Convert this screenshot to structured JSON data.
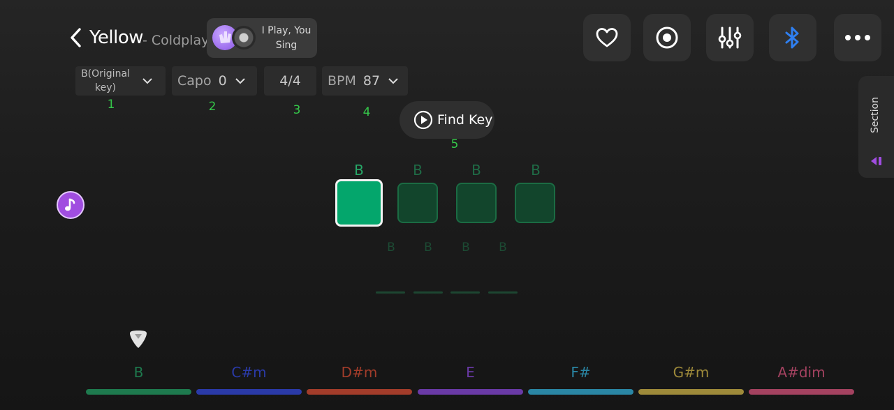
{
  "header": {
    "title": "Yellow",
    "artist": "- Coldplay",
    "mode": "I Play, You Sing"
  },
  "toolbar": {
    "favorite_icon": "heart-icon",
    "record_icon": "record-icon",
    "mixer_icon": "sliders-icon",
    "bluetooth_icon": "bluetooth-icon",
    "more_icon": "more-icon",
    "bluetooth_color": "#2f7ff0"
  },
  "settings": {
    "key": "B(Original key)",
    "capo_label": "Capo",
    "capo_value": "0",
    "time_signature": "4/4",
    "bpm_label": "BPM",
    "bpm_value": "87",
    "steps": [
      "1",
      "2",
      "3",
      "4",
      "5"
    ]
  },
  "find_key": {
    "label": "Find Key"
  },
  "section_tab": {
    "label": "Section"
  },
  "beats": {
    "top_labels": [
      "B",
      "B",
      "B",
      "B"
    ],
    "active_index": 0,
    "sub_labels": [
      "B",
      "B",
      "B",
      "B"
    ]
  },
  "chords": [
    {
      "name": "B",
      "color": "#1e7a4e"
    },
    {
      "name": "C#m",
      "color": "#2a3aa8"
    },
    {
      "name": "D#m",
      "color": "#a23c2a"
    },
    {
      "name": "E",
      "color": "#6a3aa6"
    },
    {
      "name": "F#",
      "color": "#2a86a4"
    },
    {
      "name": "G#m",
      "color": "#9e8a3a"
    },
    {
      "name": "A#dim",
      "color": "#a44260"
    }
  ]
}
